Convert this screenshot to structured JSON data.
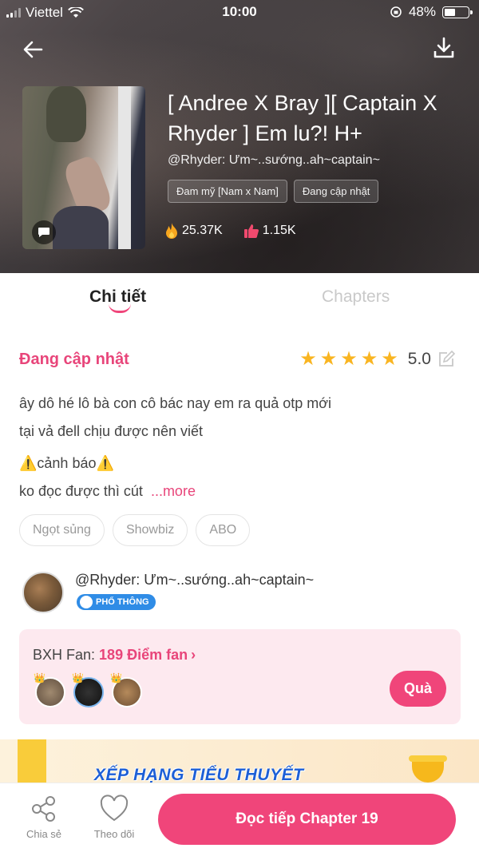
{
  "status_bar": {
    "carrier": "Viettel",
    "time": "10:00",
    "battery": "48%",
    "battery_level": 0.48
  },
  "header": {
    "title": "[ Andree X Bray ][ Captain X Rhyder ] Em lu?! H+",
    "author": "@Rhyder: Ưm~..sướng..ah~captain~",
    "genres": [
      "Đam mỹ [Nam x Nam]",
      "Đang cập nhật"
    ],
    "views": "25.37K",
    "likes": "1.15K"
  },
  "tabs": [
    {
      "label": "Chi tiết",
      "active": true
    },
    {
      "label": "Chapters",
      "active": false
    }
  ],
  "detail": {
    "status": "Đang cập nhật",
    "rating": {
      "stars": 5,
      "score": "5.0"
    },
    "description": [
      "ây dô hé lô bà con cô bác nay em ra quả otp mới",
      "tại vả đell chịu được nên viết",
      "⚠️cảnh báo⚠️",
      "ko đọc được thì cút"
    ],
    "more_label": "...more",
    "tags": [
      "Ngọt sủng",
      "Showbiz",
      "ABO"
    ]
  },
  "author_card": {
    "name": "@Rhyder: Ưm~..sướng..ah~captain~",
    "badge": "PHỔ THÔNG"
  },
  "fan_ranking": {
    "label": "BXH Fan:",
    "points": "189 Điểm fan",
    "chevron": "›",
    "gift_label": "Quà"
  },
  "banner": {
    "text": "XẾP HẠNG TIỂU THUYẾT"
  },
  "bottom_bar": {
    "share_label": "Chia sẻ",
    "follow_label": "Theo dõi",
    "read_label": "Đọc tiếp Chapter 19"
  },
  "colors": {
    "accent": "#f0457a",
    "star": "#f9b521",
    "badge": "#2f8ce6",
    "fan_bg": "#fde9ef"
  },
  "icons": [
    "back-arrow-icon",
    "download-icon",
    "chat-bubble-icon",
    "fire-icon",
    "thumbs-up-icon",
    "star-icon",
    "edit-icon",
    "share-icon",
    "heart-icon",
    "trophy-icon"
  ]
}
